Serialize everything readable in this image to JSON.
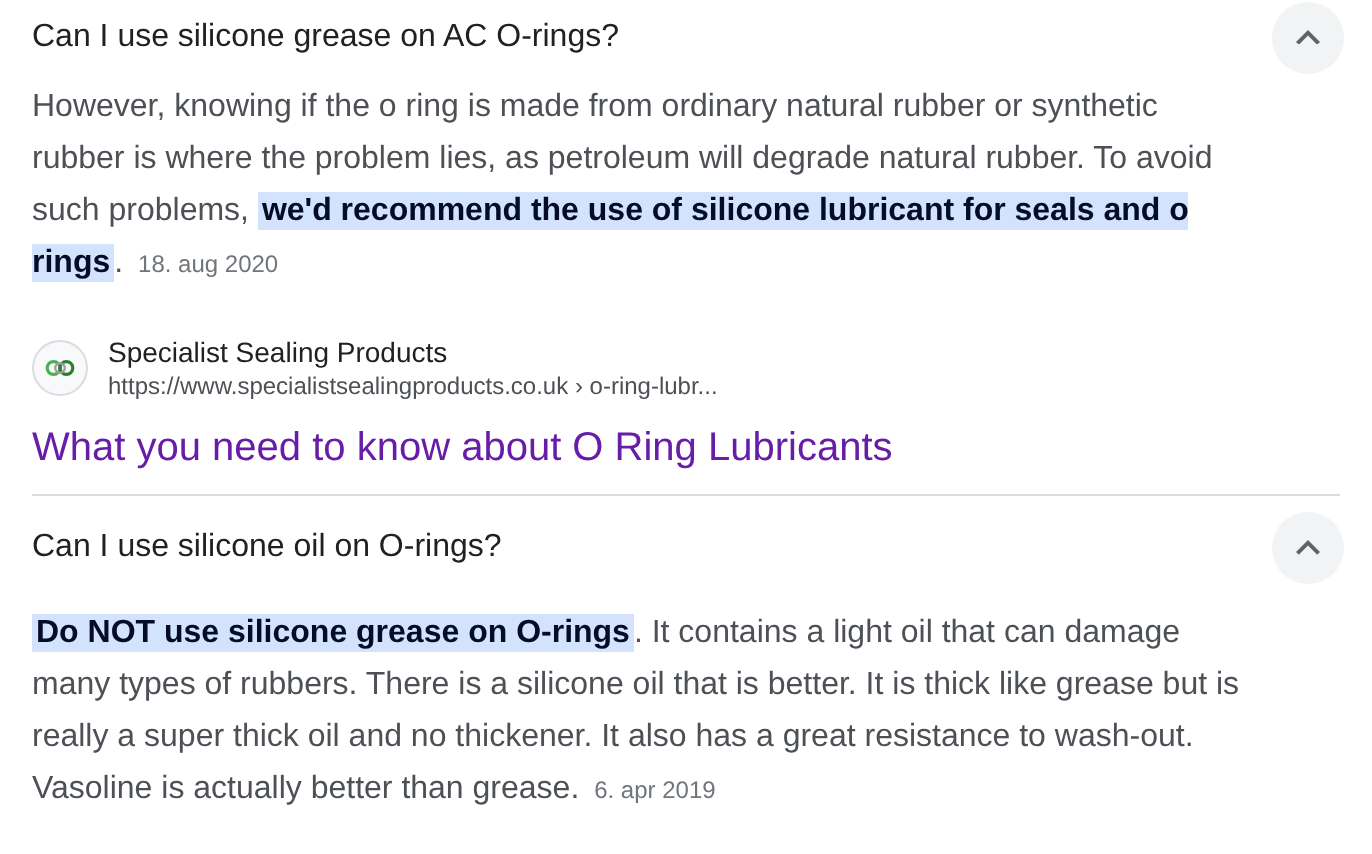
{
  "questions": [
    {
      "question": "Can I use silicone grease on AC O-rings?",
      "expanded": true,
      "answer": "However, knowing if the o ring is made from ordinary natural rubber or synthetic rubber is where the problem lies, as petroleum will degrade natural rubber. To avoid such problems, **we'd recommend the use of silicone lubricant for seals and o rings**.",
      "date": "18. aug 2020",
      "source": {
        "name": "Specialist Sealing Products",
        "url": "https://www.specialistsealingproducts.co.uk › o-ring-lubr...",
        "title": "What you need to know about O Ring Lubricants"
      }
    },
    {
      "question": "Can I use silicone oil on O-rings?",
      "expanded": true,
      "answer": "**Do NOT use silicone grease on O-rings**. It contains a light oil that can damage many types of rubbers. There is a silicone oil that is better. It is thick like grease but is really a super thick oil and no thickener. It also has a great resistance to wash-out. Vasoline is actually better than grease.",
      "date": "6. apr 2019"
    }
  ]
}
